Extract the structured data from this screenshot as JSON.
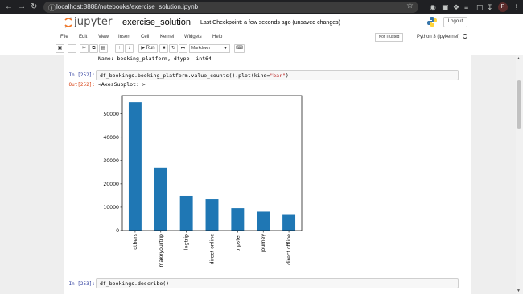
{
  "browser": {
    "url": "localhost:8888/notebooks/exercise_solution.ipynb",
    "avatar_letter": "P"
  },
  "header": {
    "logo_text": "jupyter",
    "notebook_title": "exercise_solution",
    "checkpoint": "Last Checkpoint: a few seconds ago  (unsaved changes)",
    "logout_label": "Logout"
  },
  "menu": {
    "items": [
      "File",
      "Edit",
      "View",
      "Insert",
      "Cell",
      "Kernel",
      "Widgets",
      "Help"
    ],
    "trust_label": "Not Trusted",
    "kernel_name": "Python 3 (ipykernel)"
  },
  "toolbar": {
    "run_label": "Run",
    "cell_type": "Markdown"
  },
  "cells": {
    "prev_output": "Name: booking_platform, dtype: int64",
    "cell_252": {
      "in_prompt": "In [252]:",
      "code_pre": "df_bookings.booking_platform.value_counts().plot(kind=",
      "code_str": "\"bar\"",
      "code_post": ")",
      "out_prompt": "Out[252]:",
      "out_text": "<AxesSubplot: >"
    },
    "cell_253": {
      "in_prompt": "In [253]:",
      "code": "df_bookings.describe()"
    }
  },
  "chart_data": {
    "type": "bar",
    "categories": [
      "others",
      "makeyourtrip",
      "logtrip",
      "direct online",
      "tripster",
      "journey",
      "direct offline"
    ],
    "values": [
      55000,
      26900,
      14800,
      13400,
      9600,
      8100,
      6700
    ],
    "title": "",
    "xlabel": "",
    "ylabel": "",
    "ylim": [
      0,
      57800
    ],
    "yticks": [
      "0",
      "10000",
      "20000",
      "30000",
      "40000",
      "50000"
    ],
    "bar_color": "#1f77b4",
    "grid": false
  }
}
